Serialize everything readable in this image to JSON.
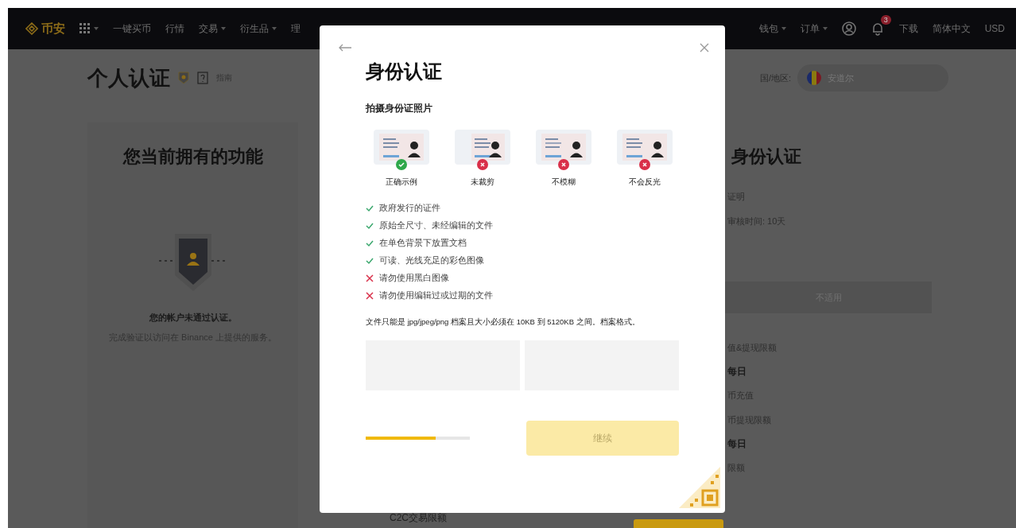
{
  "nav": {
    "logo": "币安",
    "items": [
      {
        "label": "一键买币",
        "dropdown": false
      },
      {
        "label": "行情",
        "dropdown": false
      },
      {
        "label": "交易",
        "dropdown": true
      },
      {
        "label": "衍生品",
        "dropdown": true
      },
      {
        "label": "理",
        "dropdown": false
      }
    ],
    "right_items": [
      {
        "label": "钱包",
        "dropdown": true
      },
      {
        "label": "订单",
        "dropdown": true
      }
    ],
    "notification_count": "3",
    "download": "下载",
    "language": "简体中文",
    "currency": "USD"
  },
  "page": {
    "title": "个人认证",
    "guide": "指南",
    "region_label": "国/地区:",
    "region_value": "安道尔"
  },
  "left_card": {
    "title": "您当前拥有的功能",
    "status": "您的帐户未通过认证。",
    "hint": "完成验证以访问在 Binance 上提供的服务。"
  },
  "middle": {
    "label": "C2C交易限额"
  },
  "right_card": {
    "title": "身份认证",
    "lines": [
      {
        "kind": "label",
        "text": "证明"
      },
      {
        "kind": "label",
        "text": "审核时间: 10天"
      },
      {
        "kind": "button",
        "text": "不适用"
      },
      {
        "kind": "label",
        "text": "值&提现限额"
      },
      {
        "kind": "value",
        "text": "每日"
      },
      {
        "kind": "label",
        "text": "币充值"
      },
      {
        "kind": "label",
        "text": "币提现限额"
      },
      {
        "kind": "value",
        "text": "每日"
      },
      {
        "kind": "label",
        "text": "限额"
      }
    ]
  },
  "modal": {
    "title": "身份认证",
    "subtitle": "拍摄身份证照片",
    "examples": [
      {
        "label": "正确示例",
        "ok": true
      },
      {
        "label": "未裁剪",
        "ok": false
      },
      {
        "label": "不模糊",
        "ok": false
      },
      {
        "label": "不会反光",
        "ok": false
      }
    ],
    "rules": [
      {
        "text": "政府发行的证件",
        "ok": true
      },
      {
        "text": "原始全尺寸、未经编辑的文件",
        "ok": true
      },
      {
        "text": "在单色背景下放置文档",
        "ok": true
      },
      {
        "text": "可读、光线充足的彩色图像",
        "ok": true
      },
      {
        "text": "请勿使用黑白图像",
        "ok": false
      },
      {
        "text": "请勿使用编辑过或过期的文件",
        "ok": false
      }
    ],
    "note": "文件只能是 jpg/jpeg/png 档案且大小必须在 10KB 到 5120KB 之间。档案格式。",
    "progress": {
      "level": 0.67
    },
    "continue": {
      "label": "继续",
      "disabled": true
    }
  }
}
